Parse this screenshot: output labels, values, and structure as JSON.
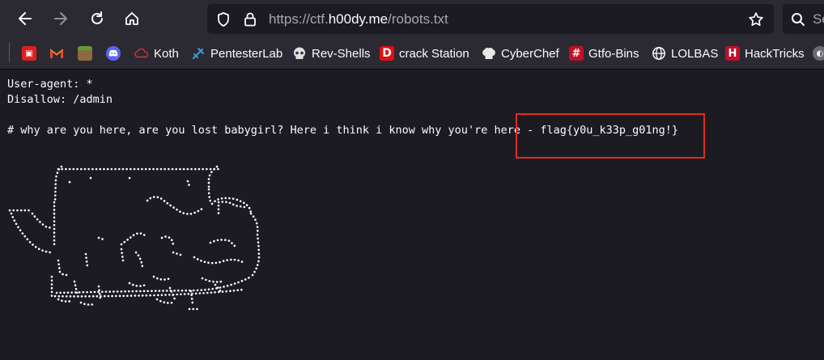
{
  "browser": {
    "url_prefix": "https://ctf.",
    "url_host": "h00dy.me",
    "url_path": "/robots.txt",
    "search_placeholder": "Se",
    "icons": {
      "back": "arrow-left-icon",
      "forward": "arrow-right-icon",
      "reload": "reload-icon",
      "home": "home-icon",
      "site_info": "shield-icon",
      "connection": "lock-icon",
      "bookmark_star": "star-icon",
      "search": "search-icon"
    }
  },
  "bookmarks": [
    {
      "label": "",
      "icon": "red-square-icon",
      "color": "#e02020"
    },
    {
      "label": "",
      "icon": "gmail-icon",
      "color": "#ea4335"
    },
    {
      "label": "",
      "icon": "minecraft-block-icon",
      "color": "#8b6a3e"
    },
    {
      "label": "",
      "icon": "discord-icon",
      "color": "#5865f2"
    },
    {
      "label": "Koth",
      "icon": "cloud-icon",
      "color": "#d23030"
    },
    {
      "label": "PentesterLab",
      "icon": "pentesterlab-icon",
      "color": "#3a9bd9"
    },
    {
      "label": "Rev-Shells",
      "icon": "skull-icon",
      "color": "#e0e0e0"
    },
    {
      "label": "crack Station",
      "icon": "d-logo-icon",
      "color": "#e01010"
    },
    {
      "label": "CyberChef",
      "icon": "chef-hat-icon",
      "color": "#e8e8e8"
    },
    {
      "label": "Gtfo-Bins",
      "icon": "hash-icon",
      "color": "#c0102a"
    },
    {
      "label": "LOLBAS",
      "icon": "globe-icon",
      "color": "#fbfbfe"
    },
    {
      "label": "HackTricks",
      "icon": "hacktricks-icon",
      "color": "#c0102a"
    }
  ],
  "page": {
    "lines": [
      "User-agent: *",
      "Disallow: /admin",
      "",
      "# why are you here, are you lost babygirl? Here i think i know why you're here - flag{y0u_k33p_g01ng!}"
    ],
    "highlight_color": "#e52b1f"
  }
}
